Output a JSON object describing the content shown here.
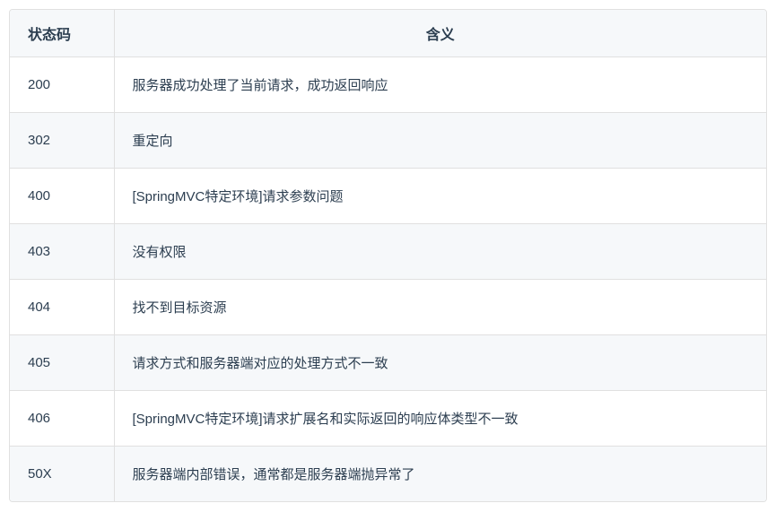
{
  "table": {
    "headers": {
      "code": "状态码",
      "meaning": "含义"
    },
    "rows": [
      {
        "code": "200",
        "meaning": "服务器成功处理了当前请求，成功返回响应"
      },
      {
        "code": "302",
        "meaning": "重定向"
      },
      {
        "code": "400",
        "meaning": "[SpringMVC特定环境]请求参数问题"
      },
      {
        "code": "403",
        "meaning": "没有权限"
      },
      {
        "code": "404",
        "meaning": "找不到目标资源"
      },
      {
        "code": "405",
        "meaning": "请求方式和服务器端对应的处理方式不一致"
      },
      {
        "code": "406",
        "meaning": "[SpringMVC特定环境]请求扩展名和实际返回的响应体类型不一致"
      },
      {
        "code": "50X",
        "meaning": "服务器端内部错误，通常都是服务器端抛异常了"
      }
    ]
  }
}
